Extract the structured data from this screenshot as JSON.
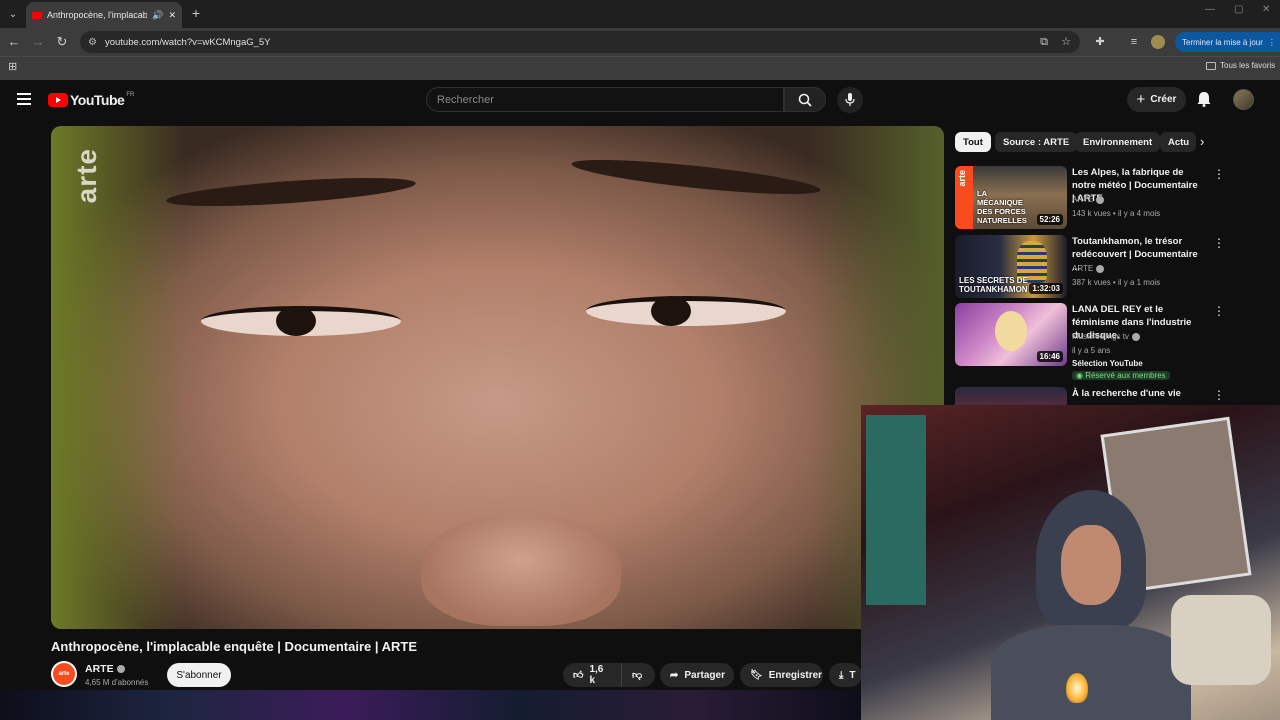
{
  "browser": {
    "tab_title": "Anthropocène, l'implacable",
    "tab_audio_icon": "speaker-icon",
    "url": "youtube.com/watch?v=wKCMngaG_5Y",
    "update_label": "Terminer la mise à jour",
    "bookmarks_all": "Tous les favoris"
  },
  "header": {
    "logo_text": "YouTube",
    "logo_region": "FR",
    "search_placeholder": "Rechercher",
    "create_label": "Créer"
  },
  "video": {
    "watermark": "arte",
    "title": "Anthropocène, l'implacable enquête | Documentaire | ARTE",
    "channel_name": "ARTE",
    "channel_avatar_text": "arte",
    "subscribers": "4,65 M d'abonnés",
    "subscribe_label": "S'abonner",
    "likes": "1,6 k",
    "share_label": "Partager",
    "save_label": "Enregistrer",
    "download_label": "T"
  },
  "chips": [
    "Tout",
    "Source : ARTE",
    "Environnement",
    "Actu"
  ],
  "recommendations": [
    {
      "title": "Les Alpes, la fabrique de notre météo | Documentaire | ARTE",
      "channel": "ARTE",
      "meta": "143 k vues • il y a 4 mois",
      "duration": "52:26",
      "thumb_text": "LA MÉCANIQUE DES FORCES NATURELLES",
      "thumb_brand": "arte"
    },
    {
      "title": "Toutankhamon, le trésor redécouvert | Documentaire ...",
      "channel": "ARTE",
      "meta": "387 k vues • il y a 1 mois",
      "duration": "1:32:03",
      "thumb_text": "LES SECRETS DE TOUTANKHAMON"
    },
    {
      "title": "LANA DEL REY et le féminisme dans l'industrie du disque.",
      "channel": "Musicfeelings tv",
      "meta": "il y a 5 ans",
      "duration": "16:46",
      "badge1": "Sélection YouTube",
      "badge2": "Réservé aux membres"
    },
    {
      "title": "À la recherche d'une vie"
    }
  ]
}
